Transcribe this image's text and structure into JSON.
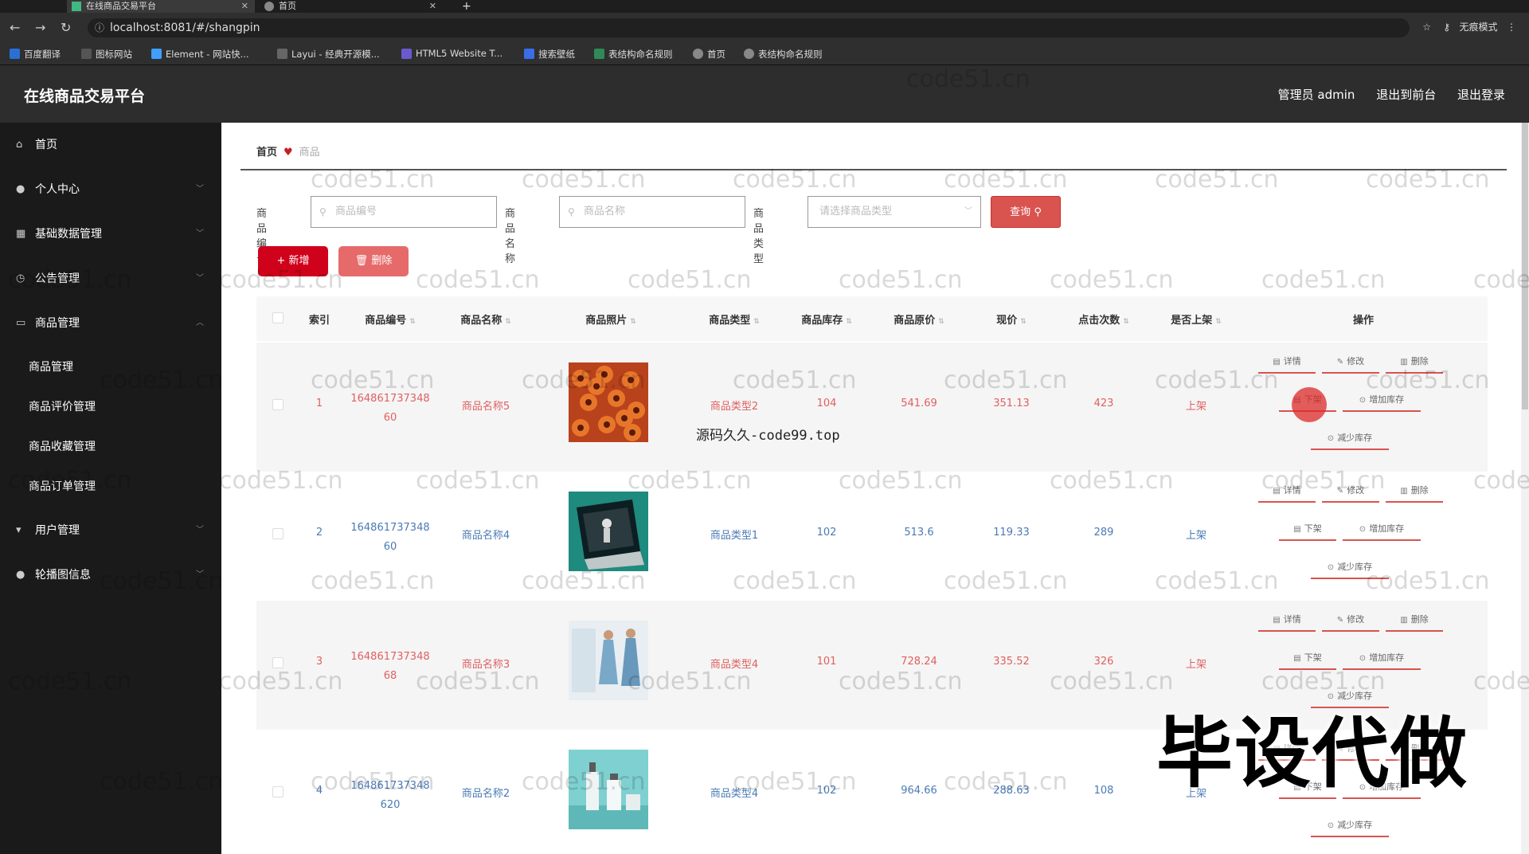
{
  "browser": {
    "tabs": [
      {
        "title": "在线商品交易平台",
        "active": true
      },
      {
        "title": "首页",
        "active": false
      }
    ],
    "new_tab": "+",
    "url": "localhost:8081/#/shangpin",
    "profile": "无痕模式",
    "bookmarks": [
      "百度翻译",
      "图标网站",
      "Element - 网站快...",
      "Layui - 经典开源模...",
      "HTML5 Website T...",
      "搜索壁纸",
      "表结构命名规则",
      "首页",
      "表结构命名规则"
    ]
  },
  "header": {
    "title": "在线商品交易平台",
    "user": "管理员 admin",
    "to_front": "退出到前台",
    "logout": "退出登录"
  },
  "sidebar": {
    "items": [
      {
        "label": "首页",
        "icon": "home-icon"
      },
      {
        "label": "个人中心",
        "icon": "user-icon"
      },
      {
        "label": "基础数据管理",
        "icon": "data-icon"
      },
      {
        "label": "公告管理",
        "icon": "notice-icon"
      },
      {
        "label": "商品管理",
        "icon": "goods-icon"
      }
    ],
    "subitems": [
      "商品管理",
      "商品评价管理",
      "商品收藏管理",
      "商品订单管理"
    ],
    "bottom_items": [
      {
        "label": "用户管理",
        "icon": "users-icon"
      },
      {
        "label": "轮播图信息",
        "icon": "carousel-icon"
      }
    ]
  },
  "breadcrumb": {
    "home": "首页",
    "current": "商品"
  },
  "search": {
    "code_label": "商品编号",
    "code_placeholder": "商品编号",
    "name_label": "商品名称",
    "name_placeholder": "商品名称",
    "type_label": "商品类型",
    "type_placeholder": "请选择商品类型",
    "query": "查询"
  },
  "actions": {
    "add": "新增",
    "delete": "删除"
  },
  "table": {
    "headers": [
      "索引",
      "商品编号",
      "商品名称",
      "商品照片",
      "商品类型",
      "商品库存",
      "商品原价",
      "现价",
      "点击次数",
      "是否上架",
      "操作"
    ],
    "rows": [
      {
        "index": "1",
        "code1": "164861737348",
        "code2": "60",
        "name": "商品名称5",
        "type": "商品类型2",
        "stock": "104",
        "orig": "541.69",
        "price": "351.13",
        "clicks": "423",
        "status": "上架",
        "color": "#e06060",
        "photo": "flowers"
      },
      {
        "index": "2",
        "code1": "164861737348",
        "code2": "60",
        "name": "商品名称4",
        "type": "商品类型1",
        "stock": "102",
        "orig": "513.6",
        "price": "119.33",
        "clicks": "289",
        "status": "上架",
        "color": "#4a7ab5",
        "photo": "laptop"
      },
      {
        "index": "3",
        "code1": "164861737348",
        "code2": "68",
        "name": "商品名称3",
        "type": "商品类型4",
        "stock": "101",
        "orig": "728.24",
        "price": "335.52",
        "clicks": "326",
        "status": "上架",
        "color": "#e06060",
        "photo": "dress"
      },
      {
        "index": "4",
        "code1": "164861737348",
        "code2": "620",
        "name": "商品名称2",
        "type": "商品类型4",
        "stock": "102",
        "orig": "964.66",
        "price": "288.63",
        "clicks": "108",
        "status": "上架",
        "color": "#4a7ab5",
        "photo": "cosmetics"
      }
    ],
    "ops": {
      "detail": "详情",
      "edit": "修改",
      "delete": "删除",
      "offshelf": "下架",
      "add_stock": "增加库存",
      "reduce_stock": "减少库存"
    }
  },
  "overlays": {
    "watermark": "code51.cn",
    "source": "源码久久-code99.top",
    "big": "毕设代做"
  }
}
